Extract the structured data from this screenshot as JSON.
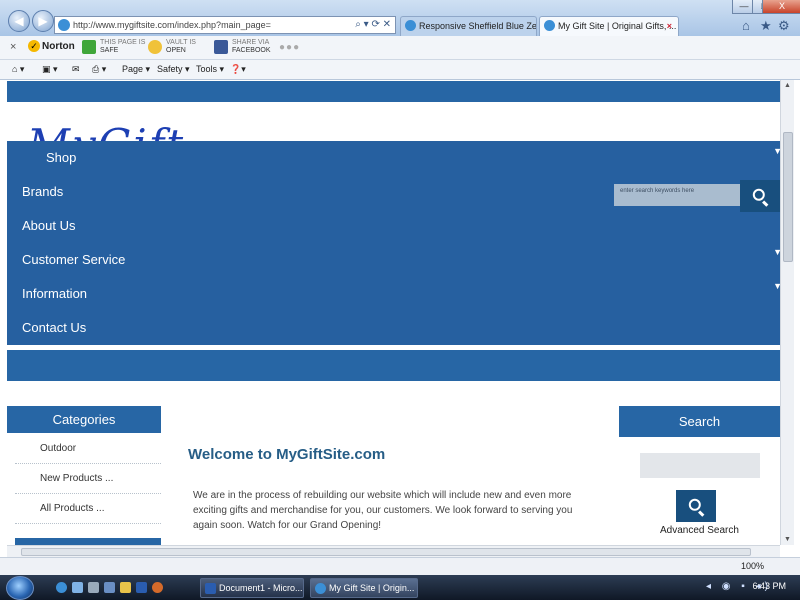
{
  "browser": {
    "address": "http://www.mygiftsite.com/index.php?main_page=",
    "address_host": "mygiftsite.com",
    "tabs": [
      {
        "title": "Responsive Sheffield Blue Zen ..."
      },
      {
        "title": "My Gift Site | Original Gifts, ..."
      }
    ],
    "window_buttons": {
      "minimize": "—",
      "maximize": "□",
      "close": "X"
    },
    "norton": {
      "logo": "Norton",
      "page_label": "THIS PAGE IS",
      "page_value": "SAFE",
      "vault_label": "VAULT IS",
      "vault_value": "OPEN",
      "share_label": "SHARE VIA",
      "share_value": "FACEBOOK",
      "dots": "●●●"
    },
    "commands": [
      "Page ▾",
      "Safety ▾",
      "Tools ▾"
    ],
    "zoom": "100%"
  },
  "site": {
    "logo_text": "MyGift",
    "nav": [
      "Shop",
      "Brands",
      "About Us",
      "Customer Service",
      "Information",
      "Contact Us"
    ],
    "search_placeholder": "enter search keywords here",
    "categories_title": "Categories",
    "categories": [
      "Outdoor",
      "New Products ...",
      "All Products ..."
    ],
    "welcome_title": "Welcome to MyGiftSite.com",
    "intro_text": "We are in the process of rebuilding our website which will include new and even more exciting gifts and merchandise for you, our customers.  We look forward to serving you again soon. Watch for our Grand Opening!",
    "search_title": "Search",
    "advanced_search": "Advanced Search"
  },
  "taskbar": {
    "tasks": [
      "Document1 - Micro...",
      "My Gift Site | Origin..."
    ],
    "clock": "6:43 PM"
  }
}
